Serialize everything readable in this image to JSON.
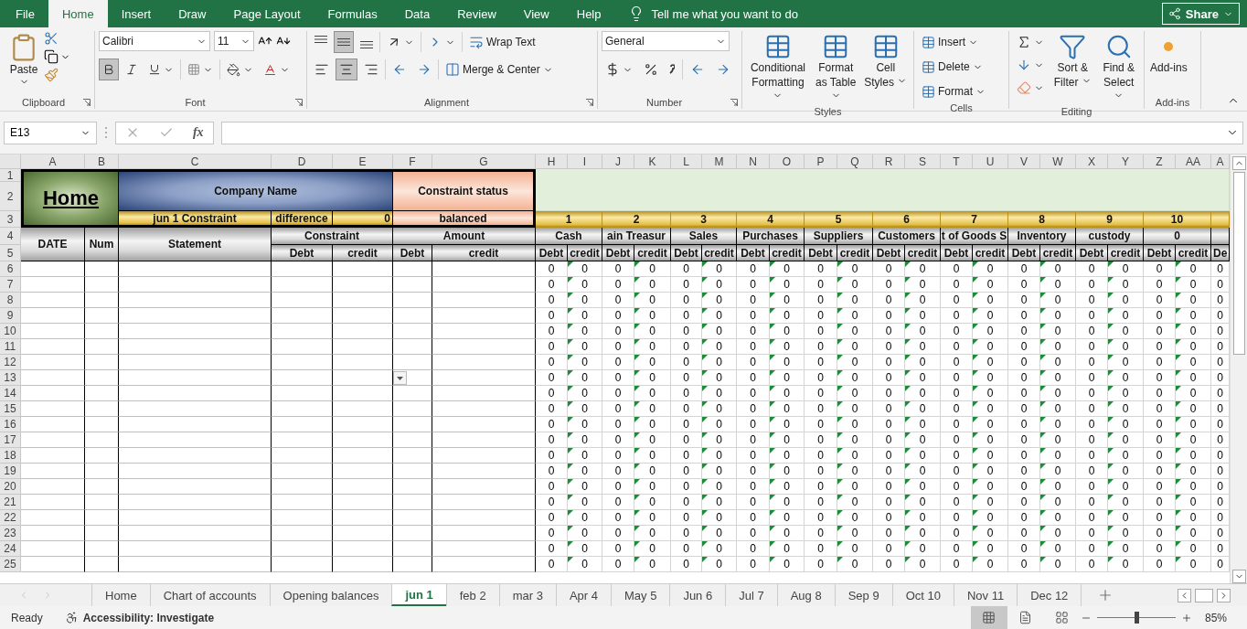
{
  "ribbon_tabs": [
    {
      "label": "File",
      "selected": false
    },
    {
      "label": "Home",
      "selected": true
    },
    {
      "label": "Insert",
      "selected": false
    },
    {
      "label": "Draw",
      "selected": false
    },
    {
      "label": "Page Layout",
      "selected": false
    },
    {
      "label": "Formulas",
      "selected": false
    },
    {
      "label": "Data",
      "selected": false
    },
    {
      "label": "Review",
      "selected": false
    },
    {
      "label": "View",
      "selected": false
    },
    {
      "label": "Help",
      "selected": false
    }
  ],
  "tell_me": "Tell me what you want to do",
  "share": "Share",
  "ribbon": {
    "clipboard": {
      "paste": "Paste",
      "label": "Clipboard"
    },
    "font": {
      "name": "Calibri",
      "size": "11",
      "bold": true,
      "italic": false,
      "label": "Font"
    },
    "alignment": {
      "middle": true,
      "center": true,
      "wrap": "Wrap Text",
      "merge": "Merge & Center",
      "label": "Alignment"
    },
    "number": {
      "format": "General",
      "label": "Number"
    },
    "styles": {
      "buttons": [
        "Conditional Formatting",
        "Format as Table",
        "Cell Styles"
      ],
      "label": "Styles"
    },
    "cells": {
      "buttons": [
        "Insert",
        "Delete",
        "Format"
      ],
      "label": "Cells"
    },
    "editing": {
      "buttons": [
        "Sort & Filter",
        "Find & Select"
      ],
      "label": "Editing"
    },
    "addins": {
      "button": "Add-ins",
      "label": "Add-ins"
    }
  },
  "formula_bar": {
    "name_box": "E13",
    "function_button": "fx"
  },
  "sheet": {
    "columns": [
      "A",
      "B",
      "C",
      "D",
      "E",
      "F",
      "G",
      "H",
      "I",
      "J",
      "K",
      "L",
      "M",
      "N",
      "O",
      "P",
      "Q",
      "R",
      "S",
      "T",
      "U",
      "V",
      "W",
      "X",
      "Y",
      "Z",
      "AA",
      "A"
    ],
    "header_row_numbers": [
      "1",
      "2",
      "3",
      "4",
      "5"
    ],
    "title_block": {
      "home_link": "Home",
      "company": "Company Name",
      "status_label": "Constraint status",
      "entry_label": "jun 1 Constraint",
      "difference_label": "difference",
      "difference_value": "0",
      "status_value": "balanced"
    },
    "account_numbers": [
      "1",
      "2",
      "3",
      "4",
      "5",
      "6",
      "7",
      "8",
      "9",
      "10"
    ],
    "left_headers": {
      "date": "DATE",
      "num": "Num",
      "statement": "Statement",
      "constraint": "Constraint",
      "amount": "Amount",
      "constraint_sub": [
        "Debt",
        "credit"
      ],
      "amount_sub": [
        "Debt",
        "credit"
      ]
    },
    "accounts": [
      {
        "name": "Cash",
        "debit": "Debt",
        "credit": "credit"
      },
      {
        "name": "ain Treasur",
        "debit": "Debt",
        "credit": "credit"
      },
      {
        "name": "Sales",
        "debit": "Debt",
        "credit": "credit"
      },
      {
        "name": "Purchases",
        "debit": "Debt",
        "credit": "credit"
      },
      {
        "name": "Suppliers",
        "debit": "Debt",
        "credit": "credit"
      },
      {
        "name": "Customers",
        "debit": "Debt",
        "credit": "credit"
      },
      {
        "name": "t of Goods S",
        "debit": "Debt",
        "credit": "credit"
      },
      {
        "name": "Inventory",
        "debit": "Debt",
        "credit": "credit"
      },
      {
        "name": "custody",
        "debit": "Debt",
        "credit": "credit"
      },
      {
        "name": "0",
        "debit": "Debt",
        "credit": "credit"
      }
    ],
    "partial_subheader": "De",
    "rows": [
      {
        "number": "6",
        "values": [
          "0",
          "0",
          "0",
          "0",
          "0",
          "0",
          "0",
          "0",
          "0",
          "0",
          "0",
          "0",
          "0",
          "0",
          "0",
          "0",
          "0",
          "0",
          "0",
          "0",
          "0"
        ]
      },
      {
        "number": "7",
        "values": [
          "0",
          "0",
          "0",
          "0",
          "0",
          "0",
          "0",
          "0",
          "0",
          "0",
          "0",
          "0",
          "0",
          "0",
          "0",
          "0",
          "0",
          "0",
          "0",
          "0",
          "0"
        ]
      },
      {
        "number": "8",
        "values": [
          "0",
          "0",
          "0",
          "0",
          "0",
          "0",
          "0",
          "0",
          "0",
          "0",
          "0",
          "0",
          "0",
          "0",
          "0",
          "0",
          "0",
          "0",
          "0",
          "0",
          "0"
        ]
      },
      {
        "number": "9",
        "values": [
          "0",
          "0",
          "0",
          "0",
          "0",
          "0",
          "0",
          "0",
          "0",
          "0",
          "0",
          "0",
          "0",
          "0",
          "0",
          "0",
          "0",
          "0",
          "0",
          "0",
          "0"
        ]
      },
      {
        "number": "10",
        "values": [
          "0",
          "0",
          "0",
          "0",
          "0",
          "0",
          "0",
          "0",
          "0",
          "0",
          "0",
          "0",
          "0",
          "0",
          "0",
          "0",
          "0",
          "0",
          "0",
          "0",
          "0"
        ]
      },
      {
        "number": "11",
        "values": [
          "0",
          "0",
          "0",
          "0",
          "0",
          "0",
          "0",
          "0",
          "0",
          "0",
          "0",
          "0",
          "0",
          "0",
          "0",
          "0",
          "0",
          "0",
          "0",
          "0",
          "0"
        ]
      },
      {
        "number": "12",
        "values": [
          "0",
          "0",
          "0",
          "0",
          "0",
          "0",
          "0",
          "0",
          "0",
          "0",
          "0",
          "0",
          "0",
          "0",
          "0",
          "0",
          "0",
          "0",
          "0",
          "0",
          "0"
        ]
      },
      {
        "number": "13",
        "values": [
          "0",
          "0",
          "0",
          "0",
          "0",
          "0",
          "0",
          "0",
          "0",
          "0",
          "0",
          "0",
          "0",
          "0",
          "0",
          "0",
          "0",
          "0",
          "0",
          "0",
          "0"
        ]
      },
      {
        "number": "14",
        "values": [
          "0",
          "0",
          "0",
          "0",
          "0",
          "0",
          "0",
          "0",
          "0",
          "0",
          "0",
          "0",
          "0",
          "0",
          "0",
          "0",
          "0",
          "0",
          "0",
          "0",
          "0"
        ]
      },
      {
        "number": "15",
        "values": [
          "0",
          "0",
          "0",
          "0",
          "0",
          "0",
          "0",
          "0",
          "0",
          "0",
          "0",
          "0",
          "0",
          "0",
          "0",
          "0",
          "0",
          "0",
          "0",
          "0",
          "0"
        ]
      },
      {
        "number": "16",
        "values": [
          "0",
          "0",
          "0",
          "0",
          "0",
          "0",
          "0",
          "0",
          "0",
          "0",
          "0",
          "0",
          "0",
          "0",
          "0",
          "0",
          "0",
          "0",
          "0",
          "0",
          "0"
        ]
      },
      {
        "number": "17",
        "values": [
          "0",
          "0",
          "0",
          "0",
          "0",
          "0",
          "0",
          "0",
          "0",
          "0",
          "0",
          "0",
          "0",
          "0",
          "0",
          "0",
          "0",
          "0",
          "0",
          "0",
          "0"
        ]
      },
      {
        "number": "18",
        "values": [
          "0",
          "0",
          "0",
          "0",
          "0",
          "0",
          "0",
          "0",
          "0",
          "0",
          "0",
          "0",
          "0",
          "0",
          "0",
          "0",
          "0",
          "0",
          "0",
          "0",
          "0"
        ]
      },
      {
        "number": "19",
        "values": [
          "0",
          "0",
          "0",
          "0",
          "0",
          "0",
          "0",
          "0",
          "0",
          "0",
          "0",
          "0",
          "0",
          "0",
          "0",
          "0",
          "0",
          "0",
          "0",
          "0",
          "0"
        ]
      },
      {
        "number": "20",
        "values": [
          "0",
          "0",
          "0",
          "0",
          "0",
          "0",
          "0",
          "0",
          "0",
          "0",
          "0",
          "0",
          "0",
          "0",
          "0",
          "0",
          "0",
          "0",
          "0",
          "0",
          "0"
        ]
      },
      {
        "number": "21",
        "values": [
          "0",
          "0",
          "0",
          "0",
          "0",
          "0",
          "0",
          "0",
          "0",
          "0",
          "0",
          "0",
          "0",
          "0",
          "0",
          "0",
          "0",
          "0",
          "0",
          "0",
          "0"
        ]
      },
      {
        "number": "22",
        "values": [
          "0",
          "0",
          "0",
          "0",
          "0",
          "0",
          "0",
          "0",
          "0",
          "0",
          "0",
          "0",
          "0",
          "0",
          "0",
          "0",
          "0",
          "0",
          "0",
          "0",
          "0"
        ]
      },
      {
        "number": "23",
        "values": [
          "0",
          "0",
          "0",
          "0",
          "0",
          "0",
          "0",
          "0",
          "0",
          "0",
          "0",
          "0",
          "0",
          "0",
          "0",
          "0",
          "0",
          "0",
          "0",
          "0",
          "0"
        ]
      },
      {
        "number": "24",
        "values": [
          "0",
          "0",
          "0",
          "0",
          "0",
          "0",
          "0",
          "0",
          "0",
          "0",
          "0",
          "0",
          "0",
          "0",
          "0",
          "0",
          "0",
          "0",
          "0",
          "0",
          "0"
        ]
      },
      {
        "number": "25",
        "values": [
          "0",
          "0",
          "0",
          "0",
          "0",
          "0",
          "0",
          "0",
          "0",
          "0",
          "0",
          "0",
          "0",
          "0",
          "0",
          "0",
          "0",
          "0",
          "0",
          "0",
          "0"
        ]
      }
    ]
  },
  "sheet_tabs": [
    {
      "label": "Home",
      "selected": false
    },
    {
      "label": "Chart of accounts",
      "selected": false
    },
    {
      "label": "Opening balances",
      "selected": false
    },
    {
      "label": "jun 1",
      "selected": true
    },
    {
      "label": "feb 2",
      "selected": false
    },
    {
      "label": "mar 3",
      "selected": false
    },
    {
      "label": "Apr 4",
      "selected": false
    },
    {
      "label": "May 5",
      "selected": false
    },
    {
      "label": "Jun 6",
      "selected": false
    },
    {
      "label": "Jul 7",
      "selected": false
    },
    {
      "label": "Aug 8",
      "selected": false
    },
    {
      "label": "Sep 9",
      "selected": false
    },
    {
      "label": "Oct 10",
      "selected": false
    },
    {
      "label": "Nov 11",
      "selected": false
    },
    {
      "label": "Dec 12",
      "selected": false
    }
  ],
  "status_bar": {
    "mode": "Ready",
    "accessibility": "Accessibility: Investigate",
    "zoom": {
      "level": 0.5,
      "reading": "85%"
    }
  }
}
